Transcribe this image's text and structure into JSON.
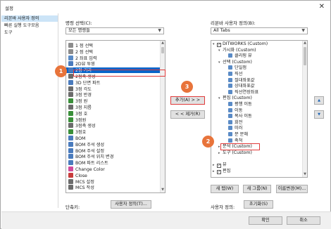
{
  "window": {
    "title": "설정",
    "close_glyph": "✕"
  },
  "nav": {
    "items": [
      {
        "label": "리본바 사용자 정의",
        "selected": true
      },
      {
        "label": "빠른 실행 도구모음",
        "selected": false
      },
      {
        "label": "도구",
        "selected": false
      }
    ]
  },
  "left": {
    "command_label": "명령 선택(C):",
    "combo_value": "모든 명령들",
    "commands": [
      {
        "label": "1 점 선택",
        "icon": "arc-icon",
        "color": "#8c8c8c",
        "selected": false
      },
      {
        "label": "2 점 선택",
        "icon": "arc-icon",
        "color": "#8c8c8c",
        "selected": false
      },
      {
        "label": "2 좌표 입력",
        "icon": "coord-icon",
        "color": "#5a8bc6",
        "selected": false
      },
      {
        "label": "2D뷰 투영",
        "icon": "projection-icon",
        "color": "#4a7bbd",
        "selected": false
      },
      {
        "label": "2점 거리",
        "icon": "distance-icon",
        "color": "#4a7bbd",
        "selected": true
      },
      {
        "label": "2점축 생성",
        "icon": "axis-icon",
        "color": "#6b6b6b",
        "selected": false
      },
      {
        "label": "3D 단면 파트",
        "icon": "section-icon",
        "color": "#4a7bbd",
        "selected": false
      },
      {
        "label": "3점 각도",
        "icon": "angle-icon",
        "color": "#6b6b6b",
        "selected": false
      },
      {
        "label": "3점 반경",
        "icon": "radius-icon",
        "color": "#6b6b6b",
        "selected": false
      },
      {
        "label": "3점 원",
        "icon": "circle-icon",
        "color": "#3a8f3a",
        "selected": false
      },
      {
        "label": "3점 지름",
        "icon": "diameter-icon",
        "color": "#6b6b6b",
        "selected": false
      },
      {
        "label": "3점 호",
        "icon": "arc-icon",
        "color": "#3a8f3a",
        "selected": false
      },
      {
        "label": "3점원",
        "icon": "circle-icon",
        "color": "#3a8f3a",
        "selected": false
      },
      {
        "label": "3점축 생성",
        "icon": "axis-icon",
        "color": "#6b6b6b",
        "selected": false
      },
      {
        "label": "3점호",
        "icon": "arc-icon",
        "color": "#3a8f3a",
        "selected": false
      },
      {
        "label": "BOM",
        "icon": "bom-icon",
        "color": "#4a7bbd",
        "selected": false
      },
      {
        "label": "BOM 주석 생성",
        "icon": "bom-note-icon",
        "color": "#4a7bbd",
        "selected": false
      },
      {
        "label": "BOM 주석 설정",
        "icon": "bom-note-icon",
        "color": "#4a7bbd",
        "selected": false
      },
      {
        "label": "BOM 주석 위치 변경",
        "icon": "bom-note-icon",
        "color": "#4a7bbd",
        "selected": false
      },
      {
        "label": "BOM 파트 리스트",
        "icon": "bom-list-icon",
        "color": "#4a7bbd",
        "selected": false
      },
      {
        "label": "Change Color",
        "icon": "color-icon",
        "color": "#d04a9c",
        "selected": false
      },
      {
        "label": "Close",
        "icon": "close-doc-icon",
        "color": "#c83c3c",
        "selected": false
      },
      {
        "label": "MCS 설정",
        "icon": "mcs-icon",
        "color": "#6b6b6b",
        "selected": false
      },
      {
        "label": "MCS 작성",
        "icon": "mcs-icon",
        "color": "#6b6b6b",
        "selected": false
      }
    ],
    "shortcut_label": "단축키:",
    "custom_button": "사용자 정의(T)..."
  },
  "middle": {
    "add_button": "추가(A) > >",
    "remove_button": "< < 제거(R)"
  },
  "right": {
    "ribbon_label": "리본바 사용자 정의(B):",
    "combo_value": "All Tabs",
    "tree": [
      {
        "level": 0,
        "tri": "▾",
        "checkbox": true,
        "label": "DITWORKS (Custom)",
        "icon": ""
      },
      {
        "level": 1,
        "tri": "▾",
        "checkbox": false,
        "label": "가시화 (Custom)",
        "icon": ""
      },
      {
        "level": 2,
        "tri": "",
        "checkbox": false,
        "label": "클리핑 뷰",
        "icon": "clip-view-icon"
      },
      {
        "level": 1,
        "tri": "▾",
        "checkbox": false,
        "label": "선택 (Custom)",
        "icon": ""
      },
      {
        "level": 2,
        "tri": "",
        "checkbox": false,
        "label": "단일점",
        "icon": "point-icon"
      },
      {
        "level": 2,
        "tri": "",
        "checkbox": false,
        "label": "직선",
        "icon": "line-icon"
      },
      {
        "level": 2,
        "tri": "",
        "checkbox": false,
        "label": "절대좌표값",
        "icon": "abs-coord-icon"
      },
      {
        "level": 2,
        "tri": "",
        "checkbox": false,
        "label": "상대좌표값",
        "icon": "rel-coord-icon"
      },
      {
        "level": 2,
        "tri": "",
        "checkbox": false,
        "label": "직선연장좌표",
        "icon": "extend-icon"
      },
      {
        "level": 1,
        "tri": "▾",
        "checkbox": false,
        "label": "편집 (Custom)",
        "icon": ""
      },
      {
        "level": 2,
        "tri": "",
        "checkbox": false,
        "label": "평행 이동",
        "icon": "move-icon"
      },
      {
        "level": 2,
        "tri": "",
        "checkbox": false,
        "label": "이동",
        "icon": "move-icon"
      },
      {
        "level": 2,
        "tri": "",
        "checkbox": false,
        "label": "복사 이동",
        "icon": "copy-icon"
      },
      {
        "level": 2,
        "tri": "",
        "checkbox": false,
        "label": "회전",
        "icon": "rotate-icon"
      },
      {
        "level": 2,
        "tri": "",
        "checkbox": false,
        "label": "미러",
        "icon": "mirror-icon"
      },
      {
        "level": 2,
        "tri": "",
        "checkbox": false,
        "label": "분 분해",
        "icon": "explode-icon"
      },
      {
        "level": 2,
        "tri": "",
        "checkbox": false,
        "label": "축척",
        "icon": "scale-icon"
      },
      {
        "level": 1,
        "tri": "▸",
        "checkbox": false,
        "label": "분석 (Custom)",
        "icon": ""
      },
      {
        "level": 1,
        "tri": "▸",
        "checkbox": false,
        "label": "도구 (Custom)",
        "icon": ""
      },
      {
        "level": 0,
        "tri": "",
        "checkbox": false,
        "label": "",
        "icon": ""
      },
      {
        "level": 0,
        "tri": "▸",
        "checkbox": true,
        "label": "뷰",
        "icon": ""
      },
      {
        "level": 0,
        "tri": "▸",
        "checkbox": true,
        "label": "편집",
        "icon": ""
      }
    ],
    "new_tab_button": "새 탭(W)",
    "new_group_button": "새 그룹(N)",
    "rename_button": "이름변경(M)...",
    "customize_label": "사용자 정의:",
    "reset_button": "초기화(S)",
    "up_glyph": "▲",
    "down_glyph": "▼"
  },
  "footer": {
    "ok_button": "확인",
    "cancel_button": "취소"
  },
  "callouts": {
    "one": "1",
    "two": "2",
    "three": "3"
  },
  "colors": {
    "accent_selection": "#0a64c8",
    "callout_orange": "#e8743b",
    "highlight_red": "#e03a3a"
  }
}
